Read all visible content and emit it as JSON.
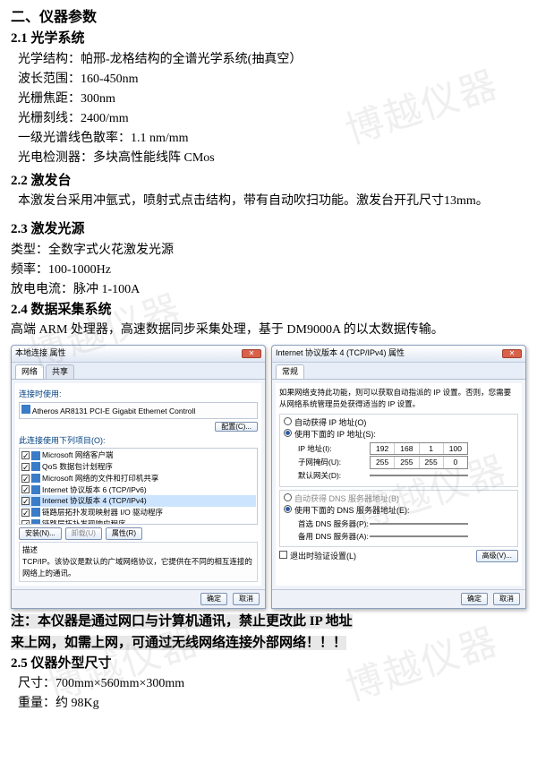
{
  "h1": "二、仪器参数",
  "s21_title": "2.1 光学系统",
  "s21_l1": "光学结构：帕邢-龙格结构的全谱光学系统(抽真空）",
  "s21_l2": "波长范围：160-450nm",
  "s21_l3": "光栅焦距：300nm",
  "s21_l4": "光栅刻线：2400/mm",
  "s21_l5": "一级光谱线色散率：1.1 nm/mm",
  "s21_l6": "光电检测器：多块高性能线阵 CMos",
  "s22_title": "2.2  激发台",
  "s22_body": "本激发台采用冲氩式，喷射式点击结构，带有自动吹扫功能。激发台开孔尺寸13mm。",
  "s23_title": "2.3  激发光源",
  "s23_l1": "类型：全数字式火花激发光源",
  "s23_l2": "频率：100-1000Hz",
  "s23_l3": "放电电流：脉冲 1-100A",
  "s24_title": "2.4  数据采集系统",
  "s24_body": "高端 ARM 处理器，高速数据同步采集处理，基于 DM9000A 的以太数据传输。",
  "win1": {
    "title": "本地连接 属性",
    "tab1": "网络",
    "tab2": "共享",
    "conn_label": "连接时使用:",
    "adapter": "Atheros AR8131 PCI-E Gigabit Ethernet Controll",
    "config_btn": "配置(C)...",
    "items_label": "此连接使用下列项目(O):",
    "item1": "Microsoft 网络客户端",
    "item2": "QoS 数据包计划程序",
    "item3": "Microsoft 网络的文件和打印机共享",
    "item4": "Internet 协议版本 6 (TCP/IPv6)",
    "item5": "Internet 协议版本 4 (TCP/IPv4)",
    "item6": "链路层拓扑发现映射器 I/O 驱动程序",
    "item7": "链路层拓扑发现响应程序",
    "install_btn": "安装(N)...",
    "uninstall_btn": "卸载(U)",
    "props_btn": "属性(R)",
    "desc_label": "描述",
    "desc_body": "TCP/IP。该协议是默认的广域网络协议，它提供在不同的相互连接的网络上的通讯。",
    "ok": "确定",
    "cancel": "取消"
  },
  "win2": {
    "title": "Internet 协议版本 4 (TCP/IPv4) 属性",
    "tab1": "常规",
    "intro": "如果网络支持此功能，则可以获取自动指派的 IP 设置。否则，您需要从网络系统管理员处获得适当的 IP 设置。",
    "r1": "自动获得 IP 地址(O)",
    "r2": "使用下面的 IP 地址(S):",
    "ip_lbl": "IP 地址(I):",
    "ip_v": [
      "192",
      "168",
      "1",
      "100"
    ],
    "mask_lbl": "子网掩码(U):",
    "mask_v": [
      "255",
      "255",
      "255",
      "0"
    ],
    "gw_lbl": "默认网关(D):",
    "gw_v": [
      "",
      "",
      "",
      ""
    ],
    "r3": "自动获得 DNS 服务器地址(B)",
    "r4": "使用下面的 DNS 服务器地址(E):",
    "dns1_lbl": "首选 DNS 服务器(P):",
    "dns2_lbl": "备用 DNS 服务器(A):",
    "exit_chk": "退出时验证设置(L)",
    "adv_btn": "高级(V)...",
    "ok": "确定",
    "cancel": "取消"
  },
  "note1": "注：本仪器是通过网口与计算机通讯，禁止更改此 IP 地址",
  "note2": "来上网，如需上网，可通过无线网络连接外部网络！！！",
  "s25_title": "2.5  仪器外型尺寸",
  "s25_l1": "尺寸：700mm×560mm×300mm",
  "s25_l2": "重量：约 98Kg"
}
